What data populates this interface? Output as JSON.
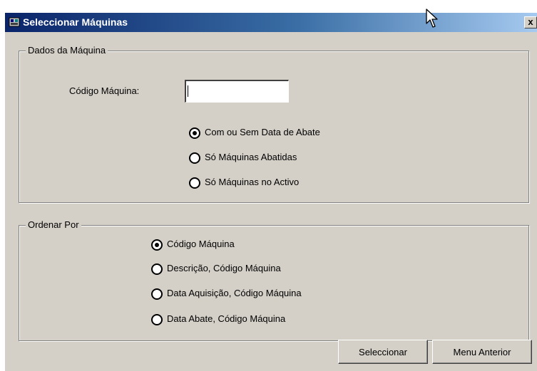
{
  "window": {
    "title": "Seleccionar Máquinas",
    "close_label": "x"
  },
  "machine_data": {
    "legend": "Dados da Máquina",
    "code_label": "Código Máquina:",
    "code_value": "",
    "filter_options": [
      {
        "label": "Com ou Sem Data de Abate",
        "selected": true
      },
      {
        "label": "Só Máquinas Abatidas",
        "selected": false
      },
      {
        "label": "Só Máquinas no Activo",
        "selected": false
      }
    ]
  },
  "order_by": {
    "legend": "Ordenar Por",
    "options": [
      {
        "label": "Código Máquina",
        "selected": true
      },
      {
        "label": "Descrição, Código Máquina",
        "selected": false
      },
      {
        "label": "Data Aquisição, Código Máquina",
        "selected": false
      },
      {
        "label": "Data Abate, Código Máquina",
        "selected": false
      }
    ]
  },
  "buttons": {
    "select": "Seleccionar",
    "back": "Menu Anterior"
  }
}
